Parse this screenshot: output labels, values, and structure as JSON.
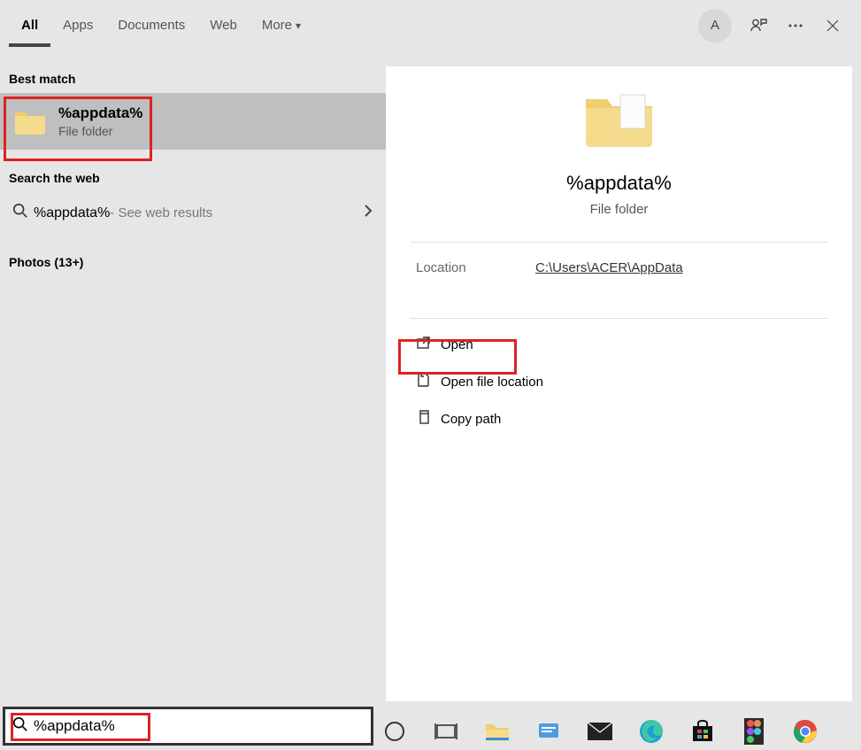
{
  "tabs": {
    "all": "All",
    "apps": "Apps",
    "documents": "Documents",
    "web": "Web",
    "more": "More"
  },
  "avatar_letter": "A",
  "sections": {
    "best_match": "Best match",
    "search_web": "Search the web",
    "photos": "Photos (13+)"
  },
  "best_match_result": {
    "title": "%appdata%",
    "subtitle": "File folder"
  },
  "web_result": {
    "query": "%appdata%",
    "hint": " - See web results"
  },
  "preview": {
    "title": "%appdata%",
    "subtitle": "File folder",
    "location_label": "Location",
    "location_path": "C:\\Users\\ACER\\AppData"
  },
  "actions": {
    "open": "Open",
    "open_location": "Open file location",
    "copy_path": "Copy path"
  },
  "search_input": "%appdata%"
}
